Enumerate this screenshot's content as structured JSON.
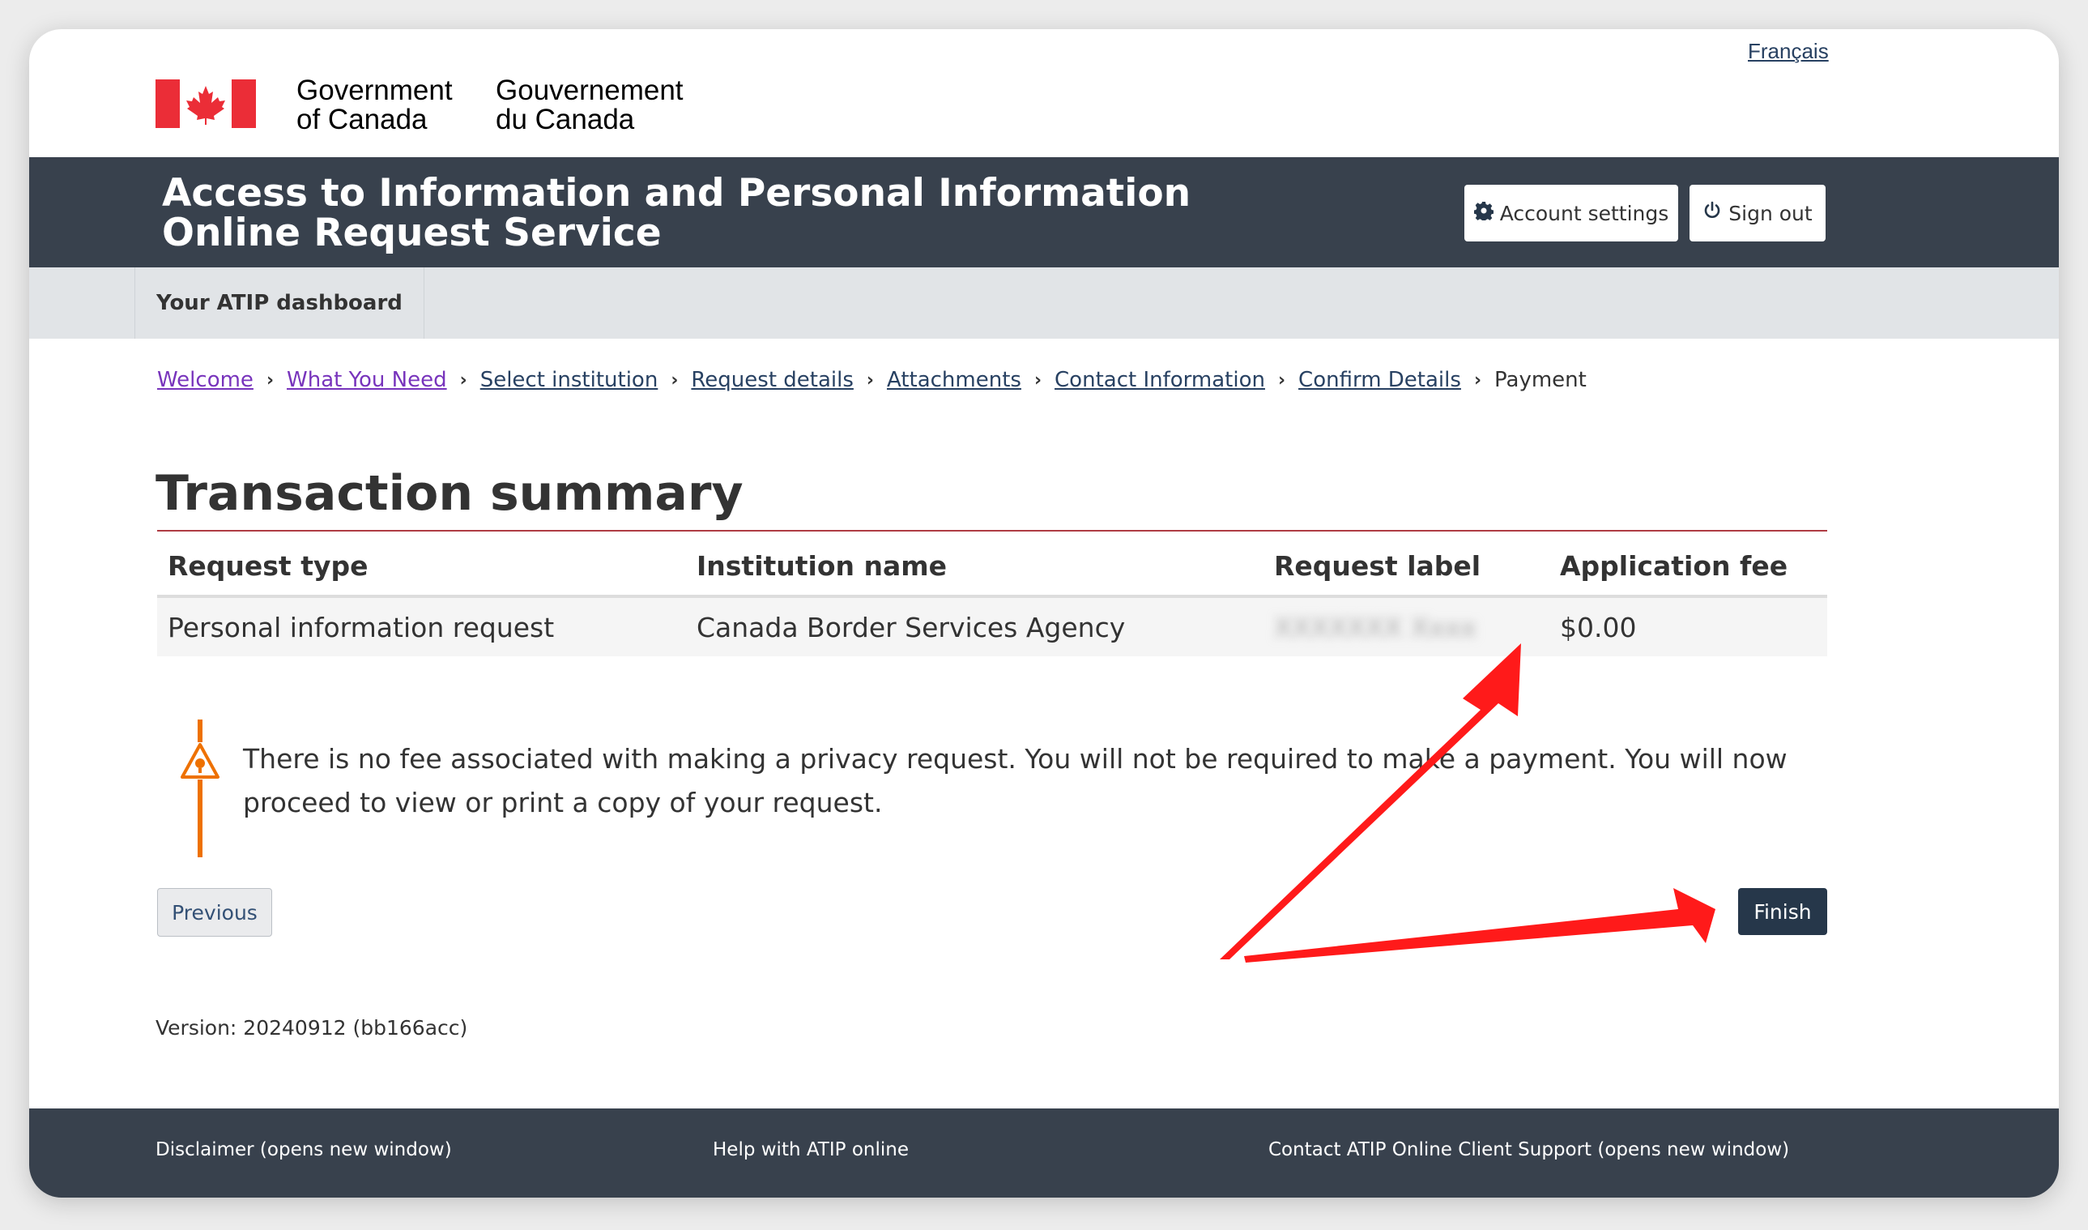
{
  "header": {
    "language_link": "Français",
    "gov_en_line1": "Government",
    "gov_en_line2": "of Canada",
    "gov_fr_line1": "Gouvernement",
    "gov_fr_line2": "du Canada",
    "service_title_line1": "Access to Information and Personal Information",
    "service_title_line2": "Online Request Service",
    "account_settings": "Account settings",
    "sign_out": "Sign out"
  },
  "nav": {
    "dashboard": "Your ATIP dashboard"
  },
  "breadcrumb": [
    "Welcome",
    "What You Need",
    "Select institution",
    "Request details",
    "Attachments",
    "Contact Information",
    "Confirm Details",
    "Payment"
  ],
  "main": {
    "title": "Transaction summary",
    "table": {
      "headers": [
        "Request type",
        "Institution name",
        "Request label",
        "Application fee"
      ],
      "row": [
        "Personal information request",
        "Canada Border Services Agency",
        "XXXXXXX Xxxx",
        "$0.00"
      ]
    },
    "warning": "There is no fee associated with making a privacy request. You will not be required to make a payment. You will now proceed to view or print a copy of your request.",
    "previous_button": "Previous",
    "finish_button": "Finish",
    "version": "Version: 20240912 (bb166acc)"
  },
  "footer": {
    "disclaimer": "Disclaimer (opens new window)",
    "help": "Help with ATIP online",
    "contact": "Contact ATIP Online Client Support (opens new window)"
  },
  "colors": {
    "title_bar": "#38414d",
    "finish_button": "#26374a",
    "warning_accent": "#ee7100",
    "annotation_arrow": "#ff1a1a"
  }
}
